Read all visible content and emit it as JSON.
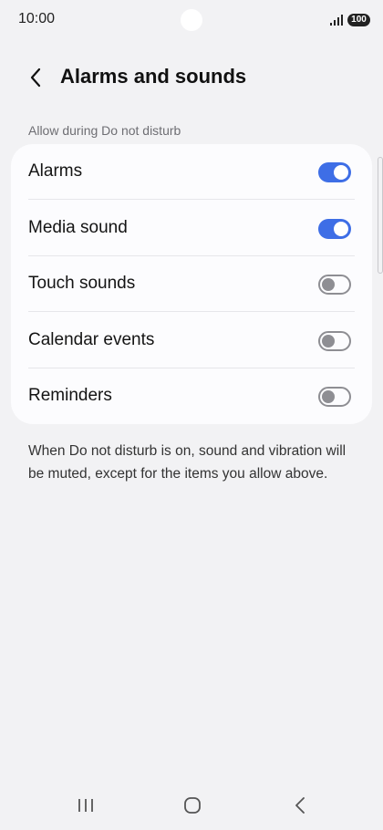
{
  "status_bar": {
    "time": "10:00",
    "battery": "100"
  },
  "header": {
    "title": "Alarms and sounds"
  },
  "section": {
    "label": "Allow during Do not disturb"
  },
  "settings": [
    {
      "label": "Alarms",
      "enabled": true
    },
    {
      "label": "Media sound",
      "enabled": true
    },
    {
      "label": "Touch sounds",
      "enabled": false
    },
    {
      "label": "Calendar events",
      "enabled": false
    },
    {
      "label": "Reminders",
      "enabled": false
    }
  ],
  "footer": {
    "text": "When Do not disturb is on, sound and vibration will be muted, except for the items you allow above."
  },
  "colors": {
    "accent": "#3e6ee6",
    "background": "#f2f2f4",
    "card": "#fcfcfe"
  }
}
